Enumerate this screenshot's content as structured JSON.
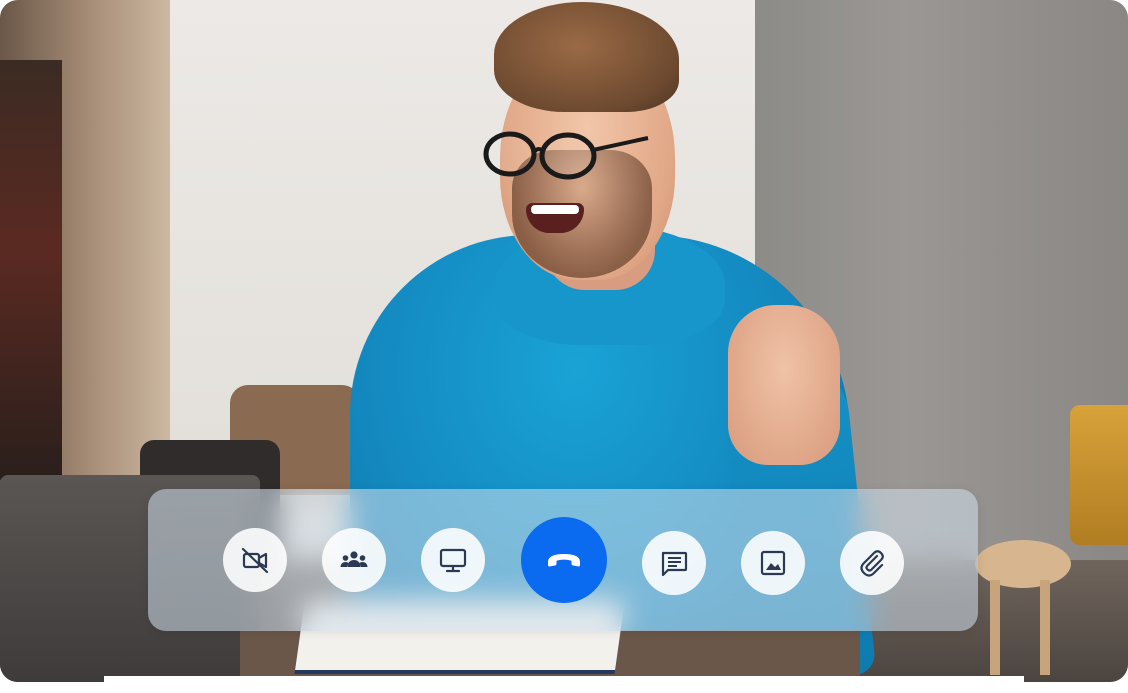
{
  "call": {
    "participant_description": "video-feed",
    "controls": [
      {
        "icon": "camera-off-icon",
        "action": "toggle-camera"
      },
      {
        "icon": "participants-icon",
        "action": "participants"
      },
      {
        "icon": "screen-share-icon",
        "action": "share-screen"
      },
      {
        "icon": "end-call-icon",
        "action": "end-call",
        "accent": "#0a6bf0"
      },
      {
        "icon": "chat-icon",
        "action": "chat"
      },
      {
        "icon": "image-icon",
        "action": "send-image"
      },
      {
        "icon": "attachment-icon",
        "action": "attach-file"
      }
    ],
    "bar_background": "#d2e0ec",
    "icon_color": "#2b3a52",
    "end_call_color": "#0a6bf0"
  }
}
